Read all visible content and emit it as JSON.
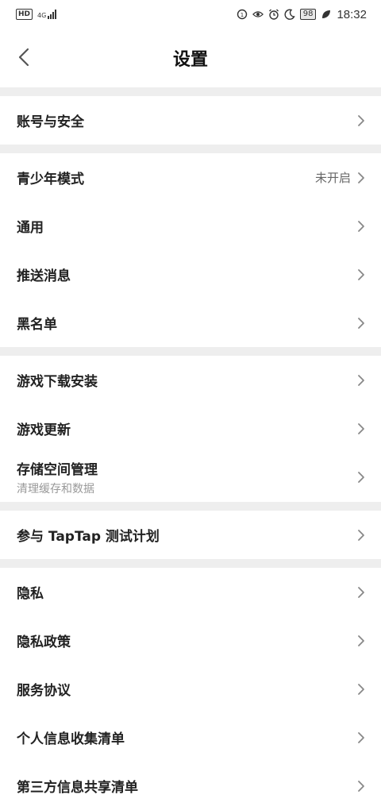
{
  "status_bar": {
    "hd": "HD",
    "network": "4G",
    "battery": "98",
    "time": "18:32"
  },
  "header": {
    "title": "设置"
  },
  "groups": [
    {
      "items": [
        {
          "label": "账号与安全"
        }
      ]
    },
    {
      "items": [
        {
          "label": "青少年模式",
          "value": "未开启"
        },
        {
          "label": "通用"
        },
        {
          "label": "推送消息"
        },
        {
          "label": "黑名单"
        }
      ]
    },
    {
      "items": [
        {
          "label": "游戏下载安装"
        },
        {
          "label": "游戏更新"
        },
        {
          "label": "存储空间管理",
          "sub": "清理缓存和数据"
        }
      ]
    },
    {
      "items": [
        {
          "label": "参与 TapTap 测试计划"
        }
      ]
    },
    {
      "items": [
        {
          "label": "隐私"
        },
        {
          "label": "隐私政策"
        },
        {
          "label": "服务协议"
        },
        {
          "label": "个人信息收集清单"
        },
        {
          "label": "第三方信息共享清单"
        }
      ]
    }
  ],
  "icons": {
    "back": "chevron-left-icon",
    "row": "chevron-right-icon"
  },
  "colors": {
    "separator": "#eeeeee",
    "chevron": "#888888"
  }
}
